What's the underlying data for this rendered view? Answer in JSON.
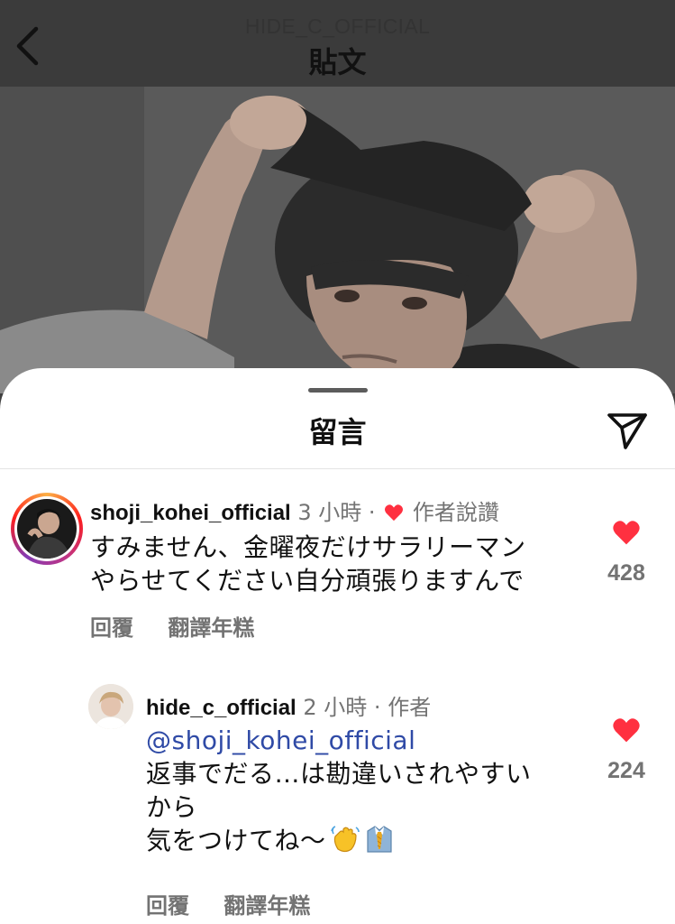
{
  "header": {
    "username": "HIDE_C_OFFICIAL",
    "title": "貼文",
    "back_icon": "chevron-left-icon"
  },
  "sheet": {
    "title": "留言",
    "share_icon": "paper-plane-icon"
  },
  "comments": [
    {
      "username": "shoji_kohei_official",
      "time": "3 小時",
      "separator": "·",
      "author_liked": "作者說讚",
      "lines": [
        "すみません、金曜夜だけサラリーマン",
        "やらせてください自分頑張りますんで"
      ],
      "likes": "428",
      "reply_label": "回覆",
      "translate_label": "翻譯年糕"
    },
    {
      "username": "hide_c_official",
      "time": "2 小時",
      "separator": "·",
      "author_tag": "作者",
      "mention": "@shoji_kohei_official",
      "lines": [
        "返事でだる…は勘違いされやすい",
        "から",
        "気をつけてね～"
      ],
      "emojis": [
        "waving-hand-icon",
        "necktie-shirt-icon"
      ],
      "likes": "224",
      "reply_label": "回覆",
      "translate_label": "翻譯年糕"
    }
  ],
  "colors": {
    "like_red": "#ff3040",
    "mention_blue": "#2f4aa6",
    "muted_gray": "#737373"
  }
}
